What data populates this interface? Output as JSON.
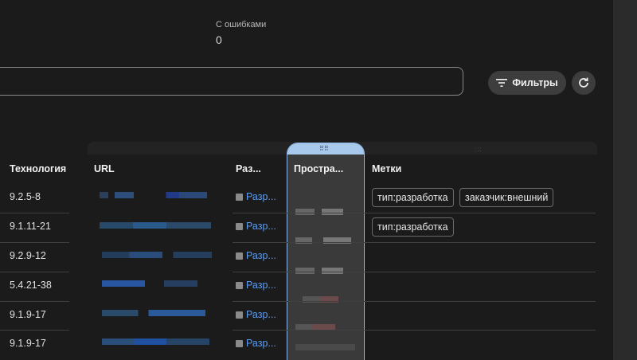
{
  "stats": {
    "errors_label": "С ошибками",
    "errors_value": "0"
  },
  "search": {
    "placeholder": ""
  },
  "toolbar": {
    "filters_label": "Фильтры",
    "filter_icon": "filter-lines-icon",
    "refresh_icon": "refresh-icon"
  },
  "table": {
    "headers": {
      "technology": "Технология",
      "url": "URL",
      "developer": "Раз...",
      "space": "Простра...",
      "tags": "Метки"
    },
    "rows": [
      {
        "technology": "9.2.5-8",
        "developer": "Разр...",
        "tags": [
          "тип:разработка",
          "заказчик:внешний"
        ]
      },
      {
        "technology": "9.1.11-21",
        "developer": "Разр...",
        "tags": [
          "тип:разработка"
        ]
      },
      {
        "technology": "9.2.9-12",
        "developer": "Разр...",
        "tags": []
      },
      {
        "technology": "5.4.21-38",
        "developer": "Разр...",
        "tags": []
      },
      {
        "technology": "9.1.9-17",
        "developer": "Разр...",
        "tags": []
      },
      {
        "technology": "9.1.9-17",
        "developer": "Разр...",
        "tags": []
      }
    ]
  },
  "colors": {
    "background": "#1b1b1c",
    "link": "#5c9cf0",
    "selected_column_border": "#8fb8e8",
    "button_bg": "#3d3d3e"
  }
}
